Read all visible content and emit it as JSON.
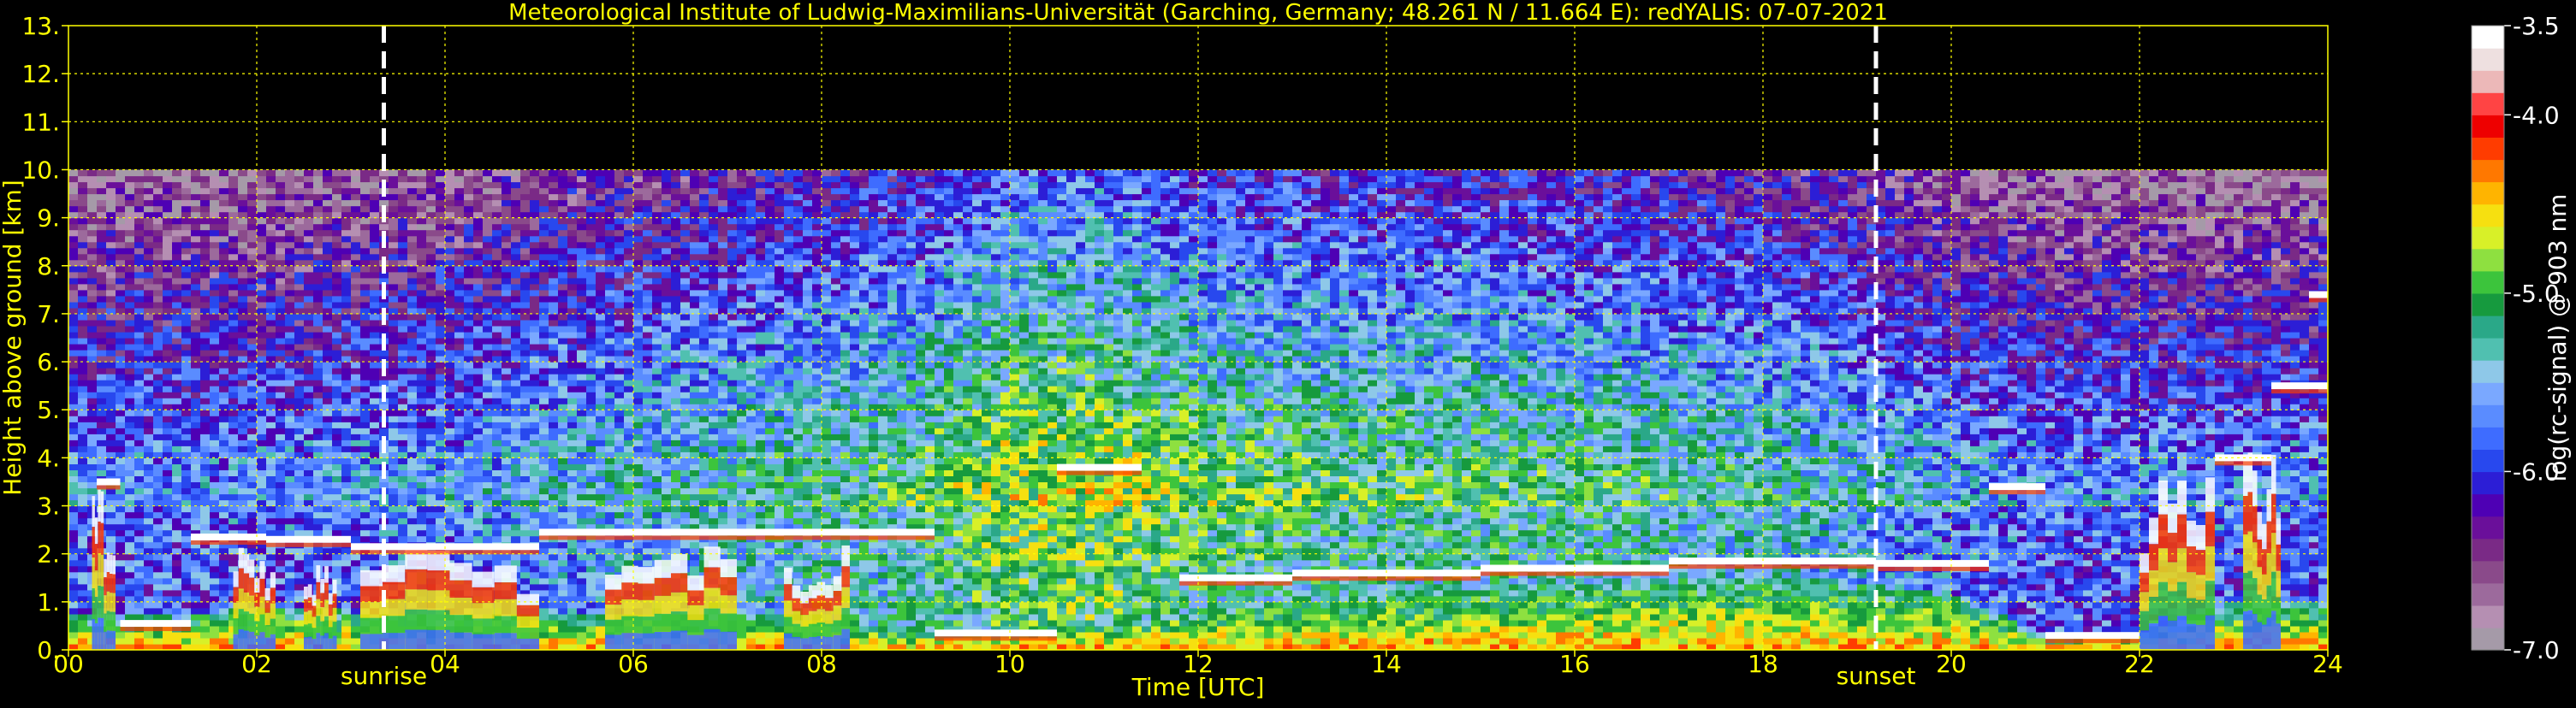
{
  "chart_data": {
    "type": "heatmap",
    "title": "Meteorological Institute of Ludwig-Maximilians-Universität (Garching, Germany; 48.261 N / 11.664 E):    redYALIS: 07-07-2021",
    "xlabel": "Time [UTC]",
    "ylabel": "Height above ground [km]",
    "xlim": [
      0,
      24
    ],
    "ylim": [
      0,
      13
    ],
    "x_ticks": [
      "00",
      "02",
      "04",
      "06",
      "08",
      "10",
      "12",
      "14",
      "16",
      "18",
      "20",
      "22",
      "24"
    ],
    "y_ticks": [
      "0.",
      "1.",
      "2.",
      "3.",
      "4.",
      "5.",
      "6.",
      "7.",
      "8.",
      "9.",
      "10.",
      "11.",
      "12.",
      "13."
    ],
    "grid": true,
    "data_top_km": 10,
    "colorbar": {
      "label": "log(rc-signal) @ 903 nm",
      "range": [
        -7.0,
        -3.5
      ],
      "ticks": [
        "-3.5",
        "-4.0",
        "-5.0",
        "-6.0",
        "-7.0"
      ],
      "colors": [
        "#a59aa8",
        "#b58fb2",
        "#9c6a9c",
        "#8a4a8a",
        "#7a2a86",
        "#6a0f9a",
        "#4e00b4",
        "#2c1ed6",
        "#2848ee",
        "#3e6cff",
        "#5a8cff",
        "#7aa8ff",
        "#8ec8e8",
        "#50c0b0",
        "#2aa888",
        "#169a3e",
        "#3cc43c",
        "#8ee040",
        "#d8f028",
        "#f6e010",
        "#ffb400",
        "#ff7800",
        "#ff3c00",
        "#ee0000",
        "#ff4444",
        "#ecb8b8",
        "#eee0e0",
        "#ffffff"
      ]
    },
    "vertical_markers": [
      {
        "label": "sunrise",
        "x": 3.35
      },
      {
        "label": "sunset",
        "x": 19.2
      }
    ],
    "cloud_base_layers": [
      {
        "x_start": 0.3,
        "x_end": 0.55,
        "y": 3.5
      },
      {
        "x_start": 0.55,
        "x_end": 1.3,
        "y": 0.55
      },
      {
        "x_start": 1.3,
        "x_end": 2.1,
        "y": 2.35
      },
      {
        "x_start": 2.1,
        "x_end": 3.0,
        "y": 2.3
      },
      {
        "x_start": 3.0,
        "x_end": 5.0,
        "y": 2.15
      },
      {
        "x_start": 5.0,
        "x_end": 7.0,
        "y": 2.45
      },
      {
        "x_start": 7.0,
        "x_end": 9.2,
        "y": 2.45
      },
      {
        "x_start": 9.2,
        "x_end": 10.5,
        "y": 0.35
      },
      {
        "x_start": 10.5,
        "x_end": 11.4,
        "y": 3.8
      },
      {
        "x_start": 11.8,
        "x_end": 13.0,
        "y": 1.5
      },
      {
        "x_start": 13.0,
        "x_end": 15.0,
        "y": 1.6
      },
      {
        "x_start": 15.0,
        "x_end": 17.0,
        "y": 1.7
      },
      {
        "x_start": 17.0,
        "x_end": 19.2,
        "y": 1.85
      },
      {
        "x_start": 19.2,
        "x_end": 20.4,
        "y": 1.8
      },
      {
        "x_start": 20.4,
        "x_end": 21.0,
        "y": 3.4
      },
      {
        "x_start": 21.0,
        "x_end": 22.0,
        "y": 0.3
      },
      {
        "x_start": 22.8,
        "x_end": 23.4,
        "y": 4.0
      },
      {
        "x_start": 23.4,
        "x_end": 24.0,
        "y": 5.5
      },
      {
        "x_start": 23.8,
        "x_end": 24.0,
        "y": 7.4
      }
    ],
    "strong_signal_plumes": [
      {
        "x_start": 0.25,
        "x_end": 0.5,
        "y_top": 3.4
      },
      {
        "x_start": 1.75,
        "x_end": 2.2,
        "y_top": 2.2
      },
      {
        "x_start": 2.5,
        "x_end": 2.85,
        "y_top": 2.0
      },
      {
        "x_start": 3.1,
        "x_end": 5.0,
        "y_top": 2.1
      },
      {
        "x_start": 5.7,
        "x_end": 7.1,
        "y_top": 2.3
      },
      {
        "x_start": 7.6,
        "x_end": 8.3,
        "y_top": 2.2
      },
      {
        "x_start": 22.0,
        "x_end": 22.8,
        "y_top": 3.6
      },
      {
        "x_start": 23.1,
        "x_end": 23.5,
        "y_top": 4.2
      }
    ],
    "boundary_layer_top": [
      [
        0,
        0.7
      ],
      [
        1,
        0.7
      ],
      [
        2,
        0.9
      ],
      [
        3,
        0.8
      ],
      [
        4,
        0.7
      ],
      [
        5,
        0.8
      ],
      [
        6,
        0.8
      ],
      [
        7,
        0.8
      ],
      [
        8,
        0.7
      ],
      [
        9,
        0.45
      ],
      [
        10,
        0.5
      ],
      [
        11,
        0.6
      ],
      [
        12,
        0.9
      ],
      [
        13,
        1.1
      ],
      [
        14,
        1.2
      ],
      [
        15,
        1.3
      ],
      [
        16,
        1.4
      ],
      [
        17,
        1.5
      ],
      [
        18,
        1.5
      ],
      [
        19,
        1.4
      ],
      [
        20,
        1.2
      ],
      [
        21,
        0.3
      ],
      [
        22,
        0.4
      ],
      [
        23,
        1.0
      ],
      [
        24,
        1.0
      ]
    ],
    "background_signal_by_hour": [
      -5.6,
      -5.6,
      -5.6,
      -5.55,
      -5.5,
      -5.4,
      -5.3,
      -5.2,
      -5.1,
      -5.0,
      -4.7,
      -4.7,
      -4.9,
      -4.95,
      -5.0,
      -5.0,
      -5.05,
      -5.1,
      -5.2,
      -5.3,
      -5.5,
      -5.6,
      -5.6,
      -5.6,
      -5.6
    ]
  }
}
